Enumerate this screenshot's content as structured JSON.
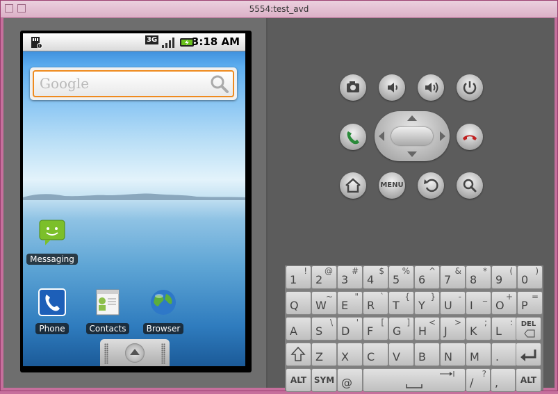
{
  "window": {
    "title": "5554:test_avd"
  },
  "status_bar": {
    "network": "3G",
    "time": "3:18 AM"
  },
  "search": {
    "placeholder": "Google"
  },
  "apps": [
    {
      "label": "Messaging"
    },
    {
      "label": "Phone"
    },
    {
      "label": "Contacts"
    },
    {
      "label": "Browser"
    }
  ],
  "hardware_buttons": {
    "menu_label": "MENU"
  },
  "keyboard": {
    "row1": [
      [
        "1",
        "!"
      ],
      [
        "2",
        "@"
      ],
      [
        "3",
        "#"
      ],
      [
        "4",
        "$"
      ],
      [
        "5",
        "%"
      ],
      [
        "6",
        "^"
      ],
      [
        "7",
        "&"
      ],
      [
        "8",
        "*"
      ],
      [
        "9",
        "("
      ],
      [
        "0",
        ")"
      ]
    ],
    "row2": [
      [
        "Q",
        ""
      ],
      [
        "W",
        "~"
      ],
      [
        "E",
        "\""
      ],
      [
        "R",
        "`"
      ],
      [
        "T",
        "{"
      ],
      [
        "Y",
        "}"
      ],
      [
        "U",
        "-"
      ],
      [
        "I",
        "_"
      ],
      [
        "O",
        "+"
      ],
      [
        "P",
        "="
      ]
    ],
    "row3": [
      [
        "A",
        ""
      ],
      [
        "S",
        "\\"
      ],
      [
        "D",
        "'"
      ],
      [
        "F",
        "["
      ],
      [
        "G",
        "]"
      ],
      [
        "H",
        "<"
      ],
      [
        "J",
        ">"
      ],
      [
        "K",
        ";"
      ],
      [
        "L",
        ":"
      ]
    ],
    "row4": [
      [
        "Z",
        ""
      ],
      [
        "X",
        ""
      ],
      [
        "C",
        ""
      ],
      [
        "V",
        ""
      ],
      [
        "B",
        ""
      ],
      [
        "N",
        ""
      ],
      [
        "M",
        ""
      ],
      [
        ".",
        ""
      ]
    ],
    "del_label": "DEL",
    "alt_label": "ALT",
    "sym_label": "SYM",
    "at_key": "@",
    "slash_key": "/",
    "question_key": "?"
  },
  "colors": {
    "search_border": "#ef8a1e",
    "window_frame": "#c66f9c",
    "call_green": "#2a8a3a",
    "end_red": "#c02020"
  }
}
